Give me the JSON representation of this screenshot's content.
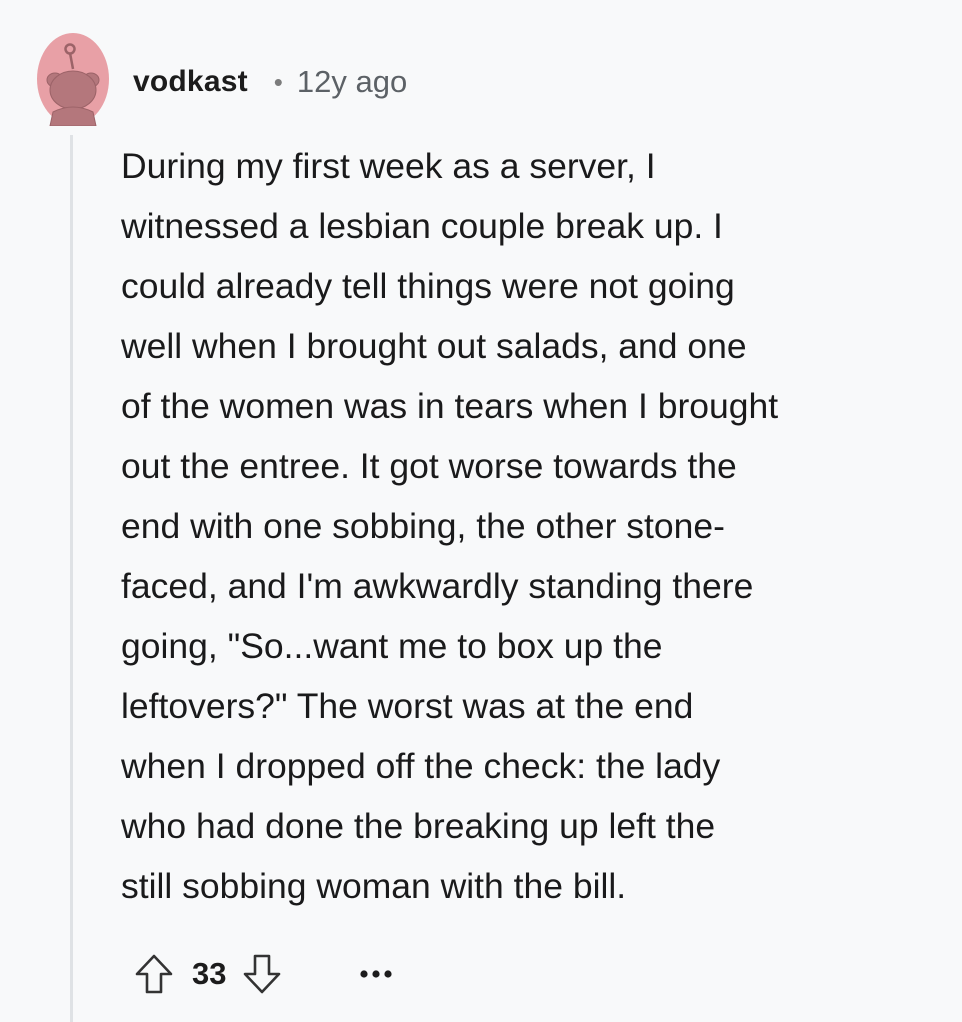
{
  "comment": {
    "author": "vodkast",
    "separator": "•",
    "timestamp": "12y ago",
    "body": "During my first week as a server, I\nwitnessed a lesbian couple break up. I\ncould already tell things were not going\nwell when I brought out salads, and one\nof the women was in tears when I brought\nout the entree. It got worse towards the\nend with one sobbing, the other stone-\nfaced, and I'm awkwardly standing there\ngoing, \"So...want me to box up the\nleftovers?\" The worst was at the end\nwhen I dropped off the check: the lady\nwho had done the breaking up left the\nstill sobbing woman with the bill.",
    "score": "33",
    "more_label": "•••"
  },
  "icons": {
    "avatar": "snoo-avatar-icon",
    "upvote": "upvote-arrow-icon",
    "downvote": "downvote-arrow-icon",
    "more": "more-options-icon"
  },
  "colors": {
    "background": "#f8f9fa",
    "avatar_bg": "#e8a0a6",
    "thread_line": "#dfe2e5",
    "text": "#1a1a1b",
    "meta": "#5c6166"
  }
}
